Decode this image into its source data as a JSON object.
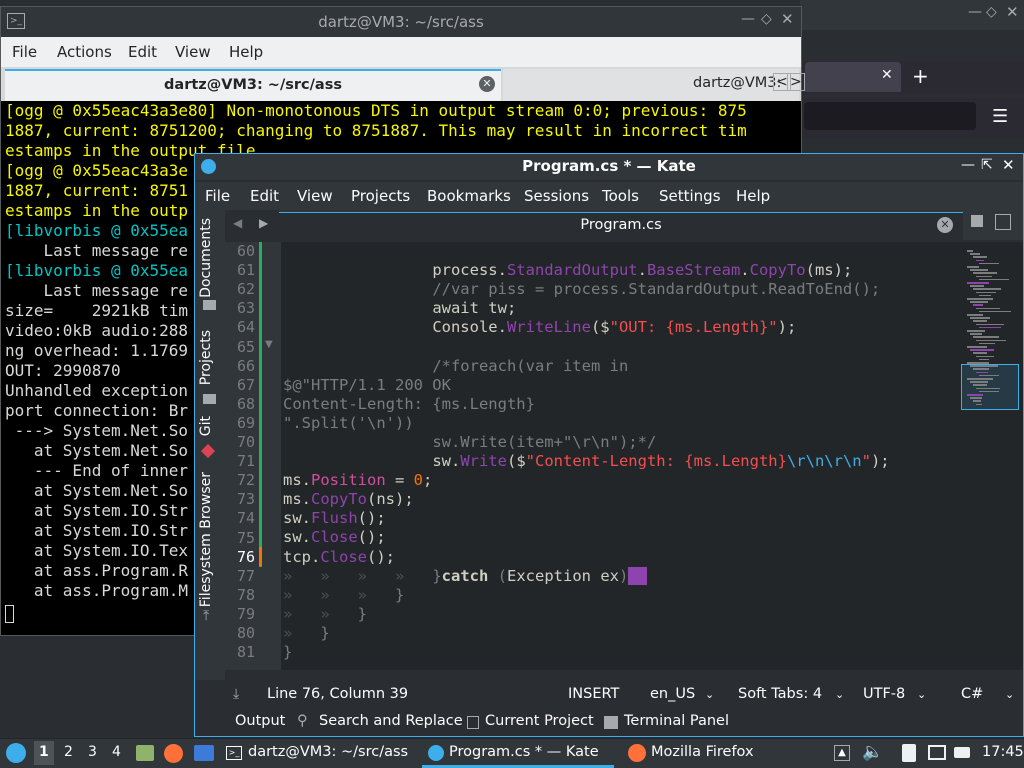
{
  "terminal": {
    "title": "dartz@VM3: ~/src/ass",
    "menu": [
      "File",
      "Actions",
      "Edit",
      "View",
      "Help"
    ],
    "tab1_label": "dartz@VM3: ~/src/ass",
    "tab2_label": "dartz@VM3:",
    "lines": [
      {
        "text": "[ogg @ 0x55eac43a3e80] Non-monotonous DTS in output stream 0:0; previous: 875",
        "color": "#f7f700"
      },
      {
        "text": "1887, current: 8751200; changing to 8751887. This may result in incorrect tim",
        "color": "#f7f700"
      },
      {
        "text": "estamps in the output file.",
        "color": "#f7f700"
      },
      {
        "text": "[ogg @ 0x55eac43a3e",
        "color": "#f7f700"
      },
      {
        "text": "1887, current: 8751",
        "color": "#f7f700"
      },
      {
        "text": "estamps in the outp",
        "color": "#f7f700"
      },
      {
        "text": "[libvorbis @ 0x55ea",
        "color": "#00c5c5"
      },
      {
        "text": "    Last message re",
        "color": "#d8d8d8"
      },
      {
        "text": "[libvorbis @ 0x55ea",
        "color": "#00c5c5"
      },
      {
        "text": "    Last message re",
        "color": "#d8d8d8"
      },
      {
        "text": "size=    2921kB tim",
        "color": "#d8d8d8"
      },
      {
        "text": "video:0kB audio:288",
        "color": "#d8d8d8"
      },
      {
        "text": "ng overhead: 1.1769",
        "color": "#d8d8d8"
      },
      {
        "text": "OUT: 2990870",
        "color": "#d8d8d8"
      },
      {
        "text": "Unhandled exception",
        "color": "#d8d8d8"
      },
      {
        "text": "port connection: Br",
        "color": "#d8d8d8"
      },
      {
        "text": " ---> System.Net.So",
        "color": "#d8d8d8"
      },
      {
        "text": "   at System.Net.So",
        "color": "#d8d8d8"
      },
      {
        "text": "   --- End of inner",
        "color": "#d8d8d8"
      },
      {
        "text": "   at System.Net.So",
        "color": "#d8d8d8"
      },
      {
        "text": "   at System.IO.Str",
        "color": "#d8d8d8"
      },
      {
        "text": "   at System.IO.Str",
        "color": "#d8d8d8"
      },
      {
        "text": "   at System.IO.Tex",
        "color": "#d8d8d8"
      },
      {
        "text": "   at ass.Program.R",
        "color": "#d8d8d8"
      },
      {
        "text": "   at ass.Program.M",
        "color": "#d8d8d8"
      }
    ]
  },
  "kate": {
    "title": "Program.cs * — Kate",
    "menu": [
      "File",
      "Edit",
      "View",
      "Projects",
      "Bookmarks",
      "Sessions",
      "Tools",
      "Settings",
      "Help"
    ],
    "sidebar_tabs": [
      "Documents",
      "Projects",
      "Git",
      "Filesystem Browser"
    ],
    "doc_tab": "Program.cs",
    "current_line": 76,
    "line_numbers": [
      "60",
      "61",
      "62",
      "63",
      "64",
      "65",
      "66",
      "67",
      "68",
      "69",
      "70",
      "71",
      "72",
      "73",
      "74",
      "75",
      "76",
      "77",
      "78",
      "79",
      "80",
      "81"
    ],
    "status": {
      "position": "Line 76, Column 39",
      "mode": "INSERT",
      "language": "en_US",
      "indent": "Soft Tabs: 4",
      "encoding": "UTF-8",
      "syntax": "C#"
    },
    "bottom_tabs": [
      "Output",
      "Search and Replace",
      "Current Project",
      "Terminal Panel"
    ]
  },
  "taskbar": {
    "desktops": [
      "1",
      "2",
      "3",
      "4"
    ],
    "tasks": [
      "dartz@VM3: ~/src/ass",
      "Program.cs * — Kate",
      "Mozilla Firefox"
    ],
    "clock": "17:45"
  },
  "colors": {
    "accent": "#3daee9",
    "terminal_yellow": "#f7f700",
    "terminal_cyan": "#00c5c5",
    "code_method": "#8e44ad",
    "code_string": "#f44f4f",
    "code_number": "#f67400"
  }
}
